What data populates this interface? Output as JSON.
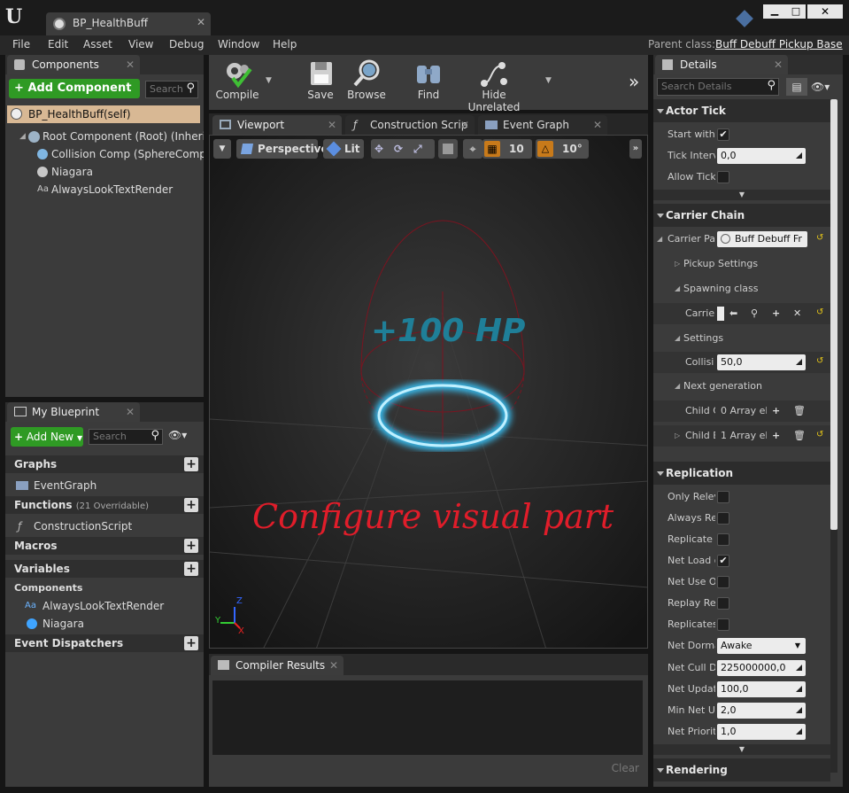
{
  "window": {
    "tab_title": "BP_HealthBuff",
    "logo": "U"
  },
  "menu": [
    "File",
    "Edit",
    "Asset",
    "View",
    "Debug",
    "Window",
    "Help"
  ],
  "parent_class": {
    "label": "Parent class:",
    "value": "Buff Debuff Pickup Base"
  },
  "components": {
    "tab": "Components",
    "add_button": "Add Component",
    "search_placeholder": "Search",
    "self_item": "BP_HealthBuff(self)",
    "tree": [
      "Root Component (Root) (Inherited)",
      "Collision Comp (SphereComp) (Inherited)",
      "Niagara",
      "AlwaysLookTextRender"
    ]
  },
  "toolbar": {
    "compile": "Compile",
    "save": "Save",
    "browse": "Browse",
    "find": "Find",
    "hide_unrelated": "Hide Unrelated"
  },
  "editor_tabs": {
    "viewport": "Viewport",
    "construction": "Construction Scrip",
    "event_graph": "Event Graph"
  },
  "viewport": {
    "perspective": "Perspective",
    "lit": "Lit",
    "grid_snap": "10",
    "rot_snap": "10°",
    "hp_text": "+100 HP",
    "annotation": "Configure visual part",
    "axis_x": "X",
    "axis_y": "Y",
    "axis_z": "Z"
  },
  "my_blueprint": {
    "tab": "My Blueprint",
    "add_new": "Add New",
    "search_placeholder": "Search",
    "graphs": "Graphs",
    "event_graph": "EventGraph",
    "functions": "Functions",
    "functions_note": "(21 Overridable)",
    "construction_script": "ConstructionScript",
    "macros": "Macros",
    "variables": "Variables",
    "components_cat": "Components",
    "var_items": [
      "AlwaysLookTextRender",
      "Niagara"
    ],
    "event_dispatchers": "Event Dispatchers"
  },
  "compiler": {
    "tab": "Compiler Results",
    "clear": "Clear"
  },
  "details": {
    "tab": "Details",
    "search_placeholder": "Search Details",
    "actor_tick": {
      "title": "Actor Tick",
      "start_with": "Start with",
      "tick_interval": "Tick Interv",
      "tick_interval_value": "0,0",
      "allow_tick": "Allow Tick"
    },
    "carrier_chain": {
      "title": "Carrier Chain",
      "carrier_pa": "Carrier Pa",
      "carrier_value": "Buff Debuff Fr",
      "pickup_settings": "Pickup Settings",
      "spawning_class": "Spawning class",
      "carrier": "Carrier",
      "settings": "Settings",
      "collision": "Collisi",
      "collision_value": "50,0",
      "next_generation": "Next generation",
      "child_c": "Child C",
      "child_c_value": "0 Array el",
      "child_e": "Child E",
      "child_e_value": "1 Array el"
    },
    "replication": {
      "title": "Replication",
      "rows": [
        {
          "label": "Only Relev",
          "checked": false
        },
        {
          "label": "Always Re",
          "checked": false
        },
        {
          "label": "Replicate I",
          "checked": false
        },
        {
          "label": "Net Load o",
          "checked": true
        },
        {
          "label": "Net Use O",
          "checked": false
        },
        {
          "label": "Replay Rev",
          "checked": false
        },
        {
          "label": "Replicates",
          "checked": false
        }
      ],
      "net_dormancy": "Net Dorma",
      "net_dormancy_value": "Awake",
      "net_cull": "Net Cull Di",
      "net_cull_value": "225000000,0",
      "net_update": "Net Updat",
      "net_update_value": "100,0",
      "min_net": "Min Net Up",
      "min_net_value": "2,0",
      "net_priority": "Net Priorit",
      "net_priority_value": "1,0"
    },
    "rendering": "Rendering"
  },
  "colors": {
    "accent_green": "#2f9a24",
    "self_row": "#d8b894",
    "hp_text": "#1f7f98",
    "annotation": "#e01d2a",
    "ring": "#39c8ff"
  }
}
